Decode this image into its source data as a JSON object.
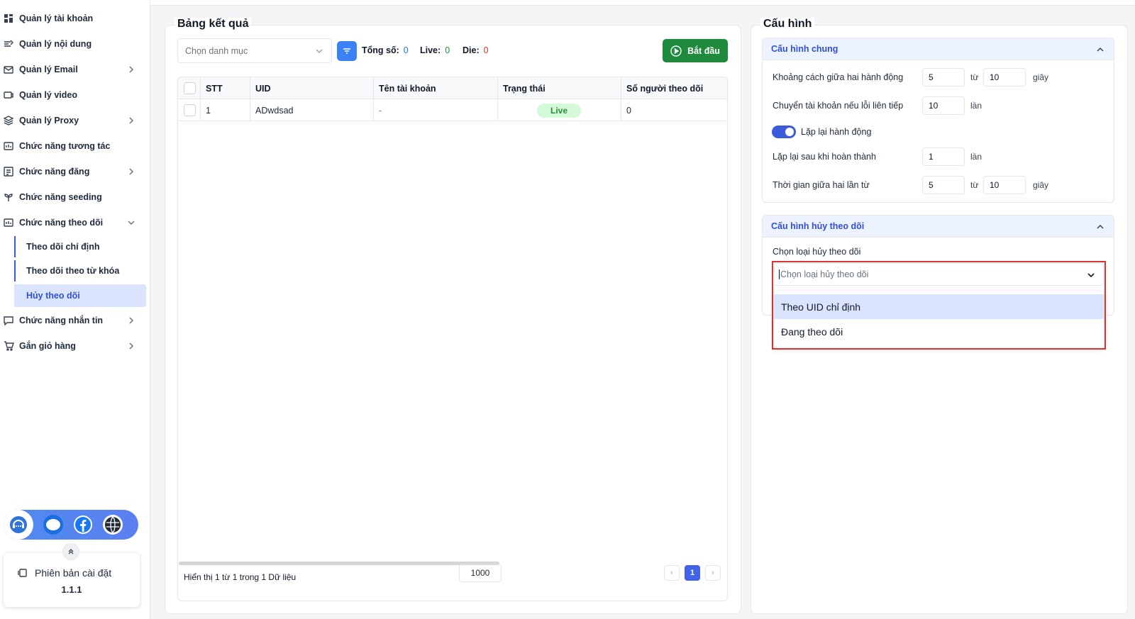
{
  "sidebar": {
    "items": [
      {
        "label": "Quản lý tài khoản",
        "icon": "grid-icon",
        "chevron": false
      },
      {
        "label": "Quản lý nội dung",
        "icon": "content-icon",
        "chevron": false
      },
      {
        "label": "Quản lý Email",
        "icon": "email-icon",
        "chevron": true
      },
      {
        "label": "Quản lý video",
        "icon": "video-icon",
        "chevron": false
      },
      {
        "label": "Quản lý Proxy",
        "icon": "proxy-icon",
        "chevron": true
      },
      {
        "label": "Chức năng tương tác",
        "icon": "interact-icon",
        "chevron": false
      },
      {
        "label": "Chức năng đăng",
        "icon": "post-icon",
        "chevron": true
      },
      {
        "label": "Chức năng seeding",
        "icon": "seeding-icon",
        "chevron": false
      },
      {
        "label": "Chức năng theo dõi",
        "icon": "follow-icon",
        "chevron": true,
        "expanded": true
      }
    ],
    "sub_items": [
      {
        "label": "Theo dõi chỉ định"
      },
      {
        "label": "Theo dõi theo từ khóa"
      },
      {
        "label": "Hủy theo dõi",
        "active": true
      }
    ],
    "items_after": [
      {
        "label": "Chức năng nhắn tin",
        "icon": "message-icon",
        "chevron": true
      },
      {
        "label": "Gắn giỏ hàng",
        "icon": "cart-icon",
        "chevron": true
      }
    ],
    "social": {
      "zalo_label": "Zalo"
    },
    "version": {
      "label": "Phiên bản cài đặt",
      "number": "1.1.1"
    }
  },
  "results": {
    "title": "Bảng kết quả",
    "category_placeholder": "Chọn danh mục",
    "total_label": "Tổng số:",
    "total_value": "0",
    "live_label": "Live:",
    "live_value": "0",
    "die_label": "Die:",
    "die_value": "0",
    "start_label": "Bắt đầu",
    "columns": [
      "STT",
      "UID",
      "Tên tài khoản",
      "Trạng thái",
      "Số người theo dõi"
    ],
    "rows": [
      {
        "stt": "1",
        "uid": "ADwdsad",
        "name": "-",
        "status": "Live",
        "followers": "0"
      }
    ],
    "footer": "Hiển thị 1 từ 1 trong 1 Dữ liệu",
    "page_size": "1000",
    "current_page": "1",
    "prev": "‹",
    "next": "›"
  },
  "config": {
    "title": "Cấu hình",
    "general": {
      "title": "Cấu hình chung",
      "interval_label": "Khoảng cách giữa hai hành động",
      "interval_from": "5",
      "interval_to": "10",
      "from_word": "từ",
      "seconds": "giây",
      "switch_label": "Chuyển tài khoản nếu lỗi liên tiếp",
      "switch_value": "10",
      "times": "lần",
      "repeat_label": "Lặp lại hành động",
      "repeat_on": true,
      "repeat_after_label": "Lặp lại sau khi hoàn thành",
      "repeat_after_value": "1",
      "between_label": "Thời gian giữa hai lần từ",
      "between_from": "5",
      "between_to": "10"
    },
    "unfollow": {
      "title": "Cấu hình hủy theo dõi",
      "type_label": "Chọn loại hủy theo dõi",
      "type_placeholder": "Chọn loại hủy theo dõi",
      "options": [
        "Theo UID chỉ định",
        "Đang theo dõi"
      ]
    }
  },
  "colors": {
    "accent": "#3b5bdb",
    "start_button": "#1e8a3c",
    "live": "#2b8a3e",
    "die": "#e03131",
    "total": "#1c7ed6",
    "highlight_box": "#e03131"
  }
}
